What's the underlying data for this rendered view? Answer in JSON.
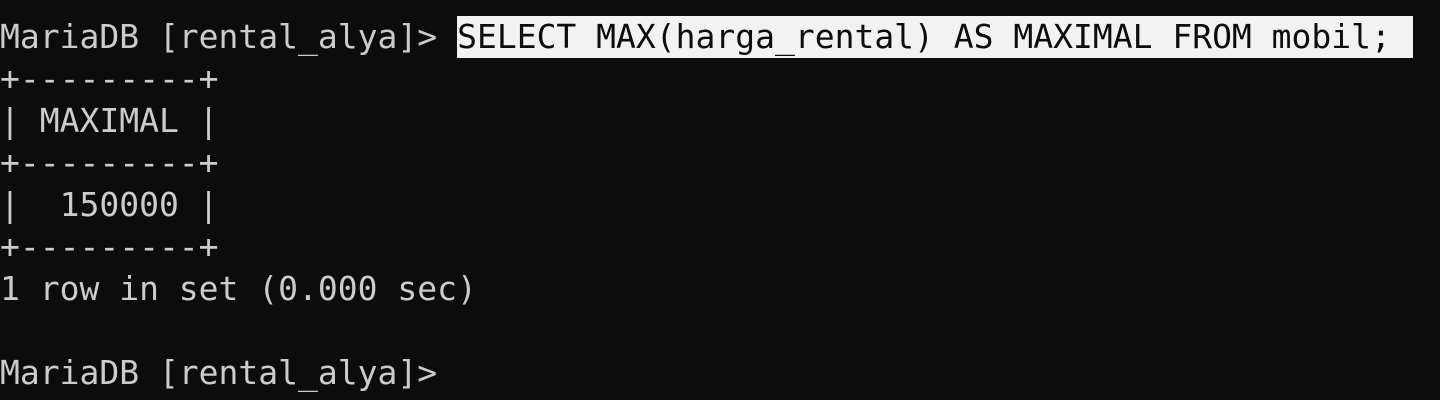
{
  "terminal": {
    "prompt": "MariaDB [rental_alya]>",
    "command": "SELECT MAX(harga_rental) AS MAXIMAL FROM mobil;",
    "table_border_top": "+---------+",
    "table_header": "| MAXIMAL |",
    "table_border_mid": "+---------+",
    "table_row": "|  150000 |",
    "table_border_bottom": "+---------+",
    "result_summary": "1 row in set (0.000 sec)",
    "final_prompt": "MariaDB [rental_alya]>"
  },
  "colors": {
    "background": "#0c0c0c",
    "foreground": "#cccccc",
    "selection_background": "#f2f2f2",
    "selection_foreground": "#0c0c0c"
  }
}
